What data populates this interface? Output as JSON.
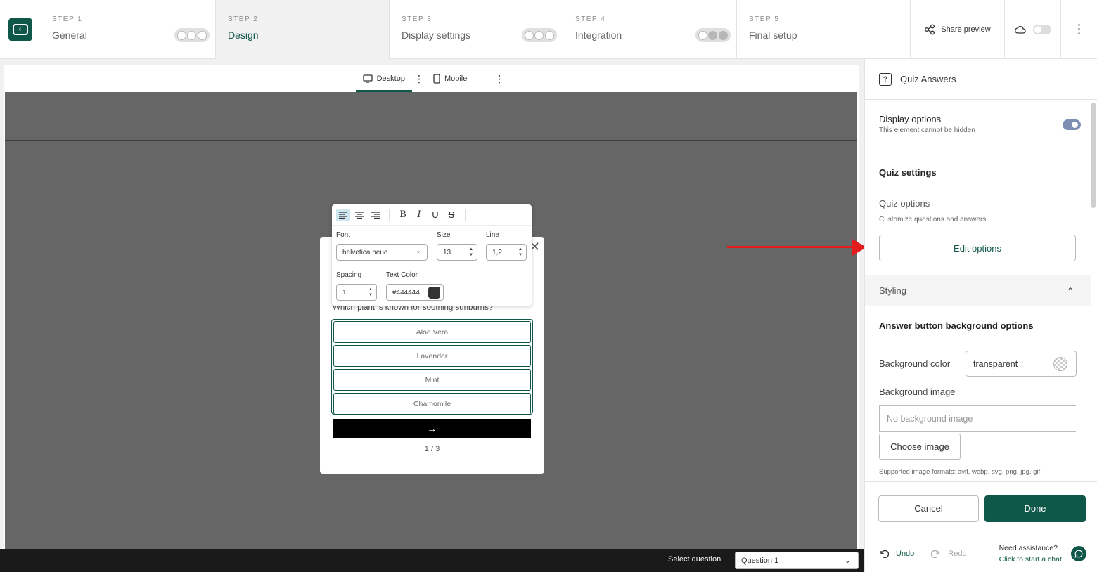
{
  "header": {
    "steps": [
      {
        "num": "STEP 1",
        "name": "General"
      },
      {
        "num": "STEP 2",
        "name": "Design"
      },
      {
        "num": "STEP 3",
        "name": "Display settings"
      },
      {
        "num": "STEP 4",
        "name": "Integration"
      },
      {
        "num": "STEP 5",
        "name": "Final setup"
      }
    ],
    "share_label": "Share preview",
    "menu_glyph": "⋮"
  },
  "device_tabs": [
    {
      "label": "Desktop",
      "active": true
    },
    {
      "label": "Mobile",
      "active": false
    }
  ],
  "kebab": "⋮",
  "text_toolbar": {
    "font_label": "Font",
    "font_value": "helvetica neue",
    "size_label": "Size",
    "size_value": "13",
    "line_label": "Line",
    "line_value": "1,2",
    "spacing_label": "Spacing",
    "spacing_value": "1",
    "color_label": "Text Color",
    "color_value": "#444444",
    "bold": "B",
    "italic": "I",
    "underline": "U",
    "strike": "S"
  },
  "quiz": {
    "question": "Which plant is known for soothing sunburns?",
    "answers": [
      "Aloe Vera",
      "Lavender",
      "Mint",
      "Chamomile"
    ],
    "next_glyph": "→",
    "pager": "1 / 3"
  },
  "bottom_bar": {
    "select_label": "Select question",
    "select_value": "Question 1"
  },
  "panel": {
    "title": "Quiz Answers",
    "display_title": "Display options",
    "display_sub": "This element cannot be hidden",
    "quiz_settings": "Quiz settings",
    "quiz_options": "Quiz options",
    "quiz_options_sub": "Customize questions and answers.",
    "edit_options": "Edit options",
    "styling": "Styling",
    "bg_options_title": "Answer button background options",
    "bg_color_label": "Background color",
    "bg_color_value": "transparent",
    "bg_image_label": "Background image",
    "bg_image_placeholder": "No background image",
    "choose_image": "Choose image",
    "formats": "Supported image formats: avif, webp, svg, png, jpg, gif",
    "cancel": "Cancel",
    "done": "Done",
    "undo": "Undo",
    "redo": "Redo",
    "assist_1": "Need assistance?",
    "assist_2": "Click to start a chat"
  },
  "colors": {
    "brand": "#0f5849",
    "arrow": "#e31d1d",
    "canvas": "#666666"
  }
}
